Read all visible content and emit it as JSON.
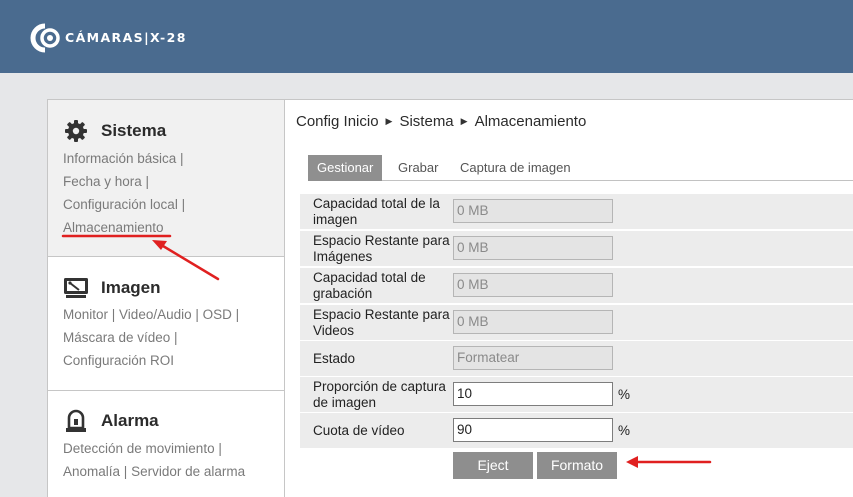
{
  "header": {
    "logo_text": "CÁMARAS|X-28"
  },
  "sidebar": {
    "sections": [
      {
        "title": "Sistema",
        "icon": "gear-icon",
        "lines": [
          [
            "Información básica |"
          ],
          [
            "Fecha y hora |"
          ],
          [
            "Configuración local |"
          ],
          [
            "Almacenamiento"
          ]
        ]
      },
      {
        "title": "Imagen",
        "icon": "monitor-icon",
        "lines": [
          [
            "Monitor |",
            "Video/Audio |",
            "OSD |"
          ],
          [
            "Máscara de vídeo |"
          ],
          [
            "Configuración ROI"
          ]
        ]
      },
      {
        "title": "Alarma",
        "icon": "alarm-icon",
        "lines": [
          [
            "Detección de movimiento |"
          ],
          [
            "Anomalía |",
            "Servidor de alarma"
          ]
        ]
      }
    ]
  },
  "breadcrumb": [
    "Config Inicio",
    "Sistema",
    "Almacenamiento"
  ],
  "tabs": [
    "Gestionar",
    "Grabar",
    "Captura de imagen"
  ],
  "form": {
    "rows": [
      {
        "label": "Capacidad total de la imagen",
        "value": "0 MB"
      },
      {
        "label": "Espacio Restante para Imágenes",
        "value": "0 MB"
      },
      {
        "label": "Capacidad total de grabación",
        "value": "0 MB"
      },
      {
        "label": "Espacio Restante para Videos",
        "value": "0 MB"
      },
      {
        "label": "Estado",
        "value": "Formatear"
      },
      {
        "label": "Proporción de captura de imagen",
        "value": "10",
        "unit": "%"
      },
      {
        "label": "Cuota de vídeo",
        "value": "90",
        "unit": "%"
      }
    ]
  },
  "buttons": {
    "eject": "Eject",
    "format": "Formato"
  },
  "colors": {
    "header_bg": "#4a6b8f",
    "annotation": "#e02020",
    "button_bg": "#8e8e8e"
  }
}
